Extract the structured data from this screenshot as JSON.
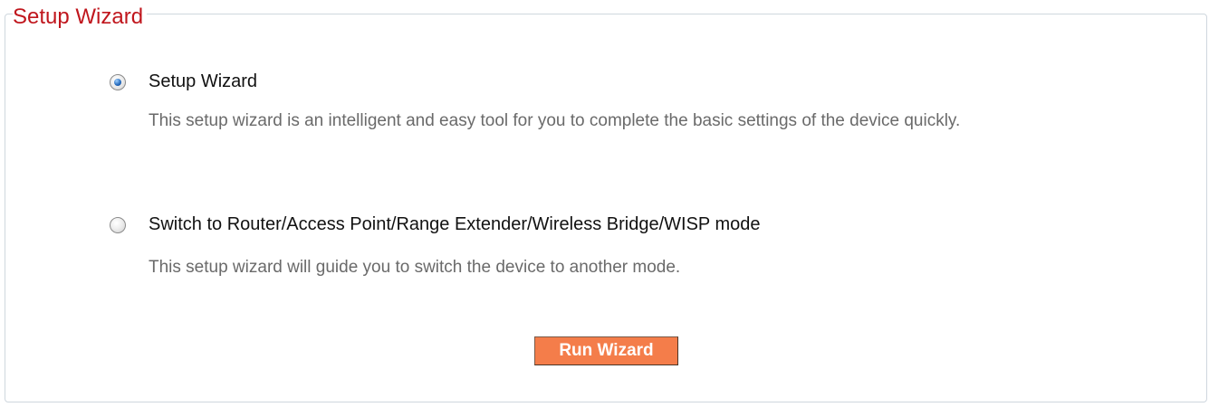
{
  "panel": {
    "title": "Setup Wizard"
  },
  "options": [
    {
      "label": "Setup Wizard",
      "description": "This setup wizard is an intelligent and easy tool for you to complete the basic settings of the device quickly.",
      "selected": true
    },
    {
      "label": "Switch to Router/Access Point/Range Extender/Wireless Bridge/WISP mode",
      "description": "This setup wizard will guide you to switch the device to another mode.",
      "selected": false
    }
  ],
  "actions": {
    "run_label": "Run Wizard"
  },
  "colors": {
    "title": "#c0161d",
    "button": "#f47d4a",
    "border": "#cfd7de"
  }
}
